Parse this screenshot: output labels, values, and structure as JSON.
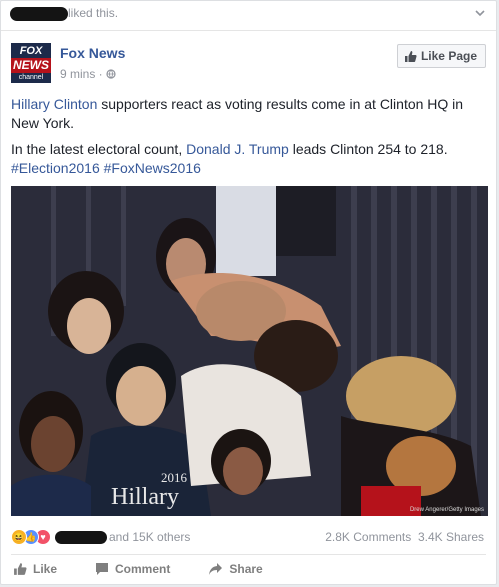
{
  "activity": {
    "suffix": "liked this."
  },
  "page": {
    "name": "Fox News",
    "time": "9 mins",
    "logo_top": "FOX",
    "logo_mid": "NEWS",
    "logo_bottom": "channel"
  },
  "like_page_button": "Like Page",
  "post": {
    "line1_link": "Hillary Clinton",
    "line1_rest": " supporters react as voting results come in at Clinton HQ in New York.",
    "line2_start": "In the latest electoral count, ",
    "line2_link": "Donald J. Trump",
    "line2_rest": " leads Clinton 254 to 218.",
    "hashtag1": "#Election2016",
    "hashtag2": "#FoxNews2016"
  },
  "photo": {
    "credit": "Drew Angerer/Getty Images",
    "shirt_text": "Hillary",
    "shirt_year": "2016"
  },
  "reactions": {
    "others": "and 15K others"
  },
  "stats": {
    "comments": "2.8K Comments",
    "shares": "3.4K Shares"
  },
  "actions": {
    "like": "Like",
    "comment": "Comment",
    "share": "Share"
  },
  "colors": {
    "link": "#365899",
    "fox_red": "#b5121b",
    "fox_navy": "#1c2a4a"
  }
}
